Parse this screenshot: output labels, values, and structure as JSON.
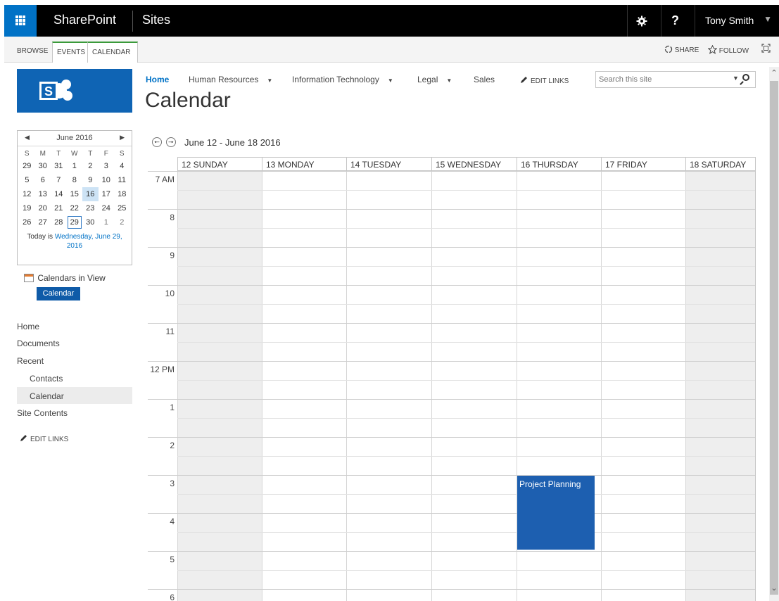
{
  "suitebar": {
    "brand": "SharePoint",
    "section": "Sites",
    "settings_icon": "gear-icon",
    "help_label": "?",
    "user_name": "Tony Smith"
  },
  "ribbon": {
    "tabs": [
      "BROWSE",
      "EVENTS",
      "CALENDAR"
    ],
    "share_label": "SHARE",
    "follow_label": "FOLLOW"
  },
  "topnav": {
    "items": [
      "Home",
      "Human Resources",
      "Information Technology",
      "Legal",
      "Sales"
    ],
    "edit_links": "EDIT LINKS",
    "search_placeholder": "Search this site"
  },
  "page_title": "Calendar",
  "minical": {
    "month_title": "June 2016",
    "weekdays": [
      "S",
      "M",
      "T",
      "W",
      "T",
      "F",
      "S"
    ],
    "weeks": [
      [
        "29",
        "30",
        "31",
        "1",
        "2",
        "3",
        "4"
      ],
      [
        "5",
        "6",
        "7",
        "8",
        "9",
        "10",
        "11"
      ],
      [
        "12",
        "13",
        "14",
        "15",
        "16",
        "17",
        "18"
      ],
      [
        "19",
        "20",
        "21",
        "22",
        "23",
        "24",
        "25"
      ],
      [
        "26",
        "27",
        "28",
        "29",
        "30",
        "1",
        "2"
      ]
    ],
    "today_prefix": "Today is ",
    "today_link": "Wednesday, June 29, 2016"
  },
  "calendars_in_view": {
    "label": "Calendars in View",
    "badge": "Calendar"
  },
  "leftnav": {
    "items": [
      "Home",
      "Documents",
      "Recent",
      "Contacts",
      "Calendar",
      "Site Contents"
    ],
    "edit_links": "EDIT LINKS"
  },
  "week": {
    "range": "June 12 - June 18 2016",
    "days": [
      "12 SUNDAY",
      "13 MONDAY",
      "14 TUESDAY",
      "15 WEDNESDAY",
      "16 THURSDAY",
      "17 FRIDAY",
      "18 SATURDAY"
    ],
    "hours": [
      "7 AM",
      "8",
      "9",
      "10",
      "11",
      "12 PM",
      "1",
      "2",
      "3",
      "4",
      "5",
      "6"
    ]
  },
  "event": {
    "title": "Project Planning"
  }
}
